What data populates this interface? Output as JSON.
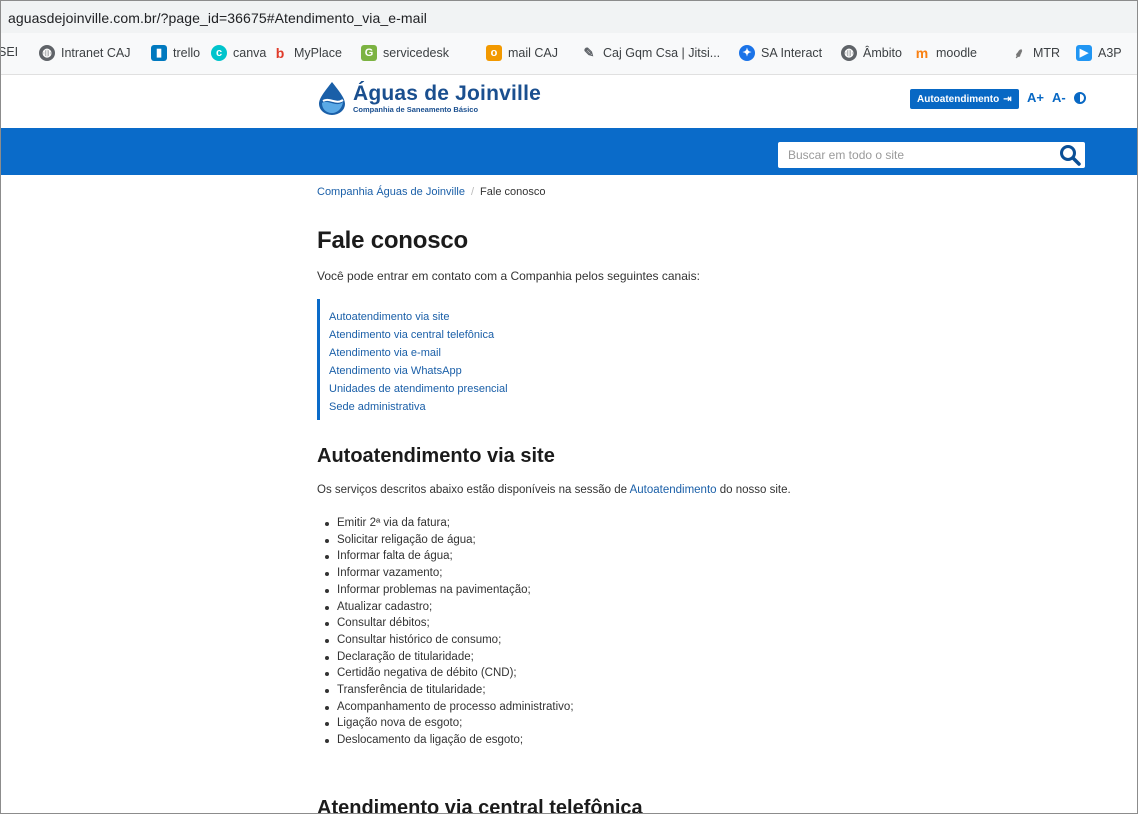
{
  "browser": {
    "url": "aguasdejoinville.com.br/?page_id=36675#Atendimento_via_e-mail"
  },
  "bookmarks": [
    {
      "label": "SEI",
      "icon": "none"
    },
    {
      "label": "Intranet CAJ",
      "icon": "globe-icon"
    },
    {
      "label": "trello",
      "icon": "trello-icon"
    },
    {
      "label": "canva",
      "icon": "canva-icon"
    },
    {
      "label": "MyPlace",
      "icon": "myplace-icon"
    },
    {
      "label": "servicedesk",
      "icon": "servicedesk-icon"
    },
    {
      "label": "mail CAJ",
      "icon": "mail-icon"
    },
    {
      "label": "Caj Gqm Csa | Jitsi...",
      "icon": "feather-icon"
    },
    {
      "label": "SA Interact",
      "icon": "sa-interact-icon"
    },
    {
      "label": "Âmbito",
      "icon": "globe-icon"
    },
    {
      "label": "moodle",
      "icon": "moodle-icon"
    },
    {
      "label": "MTR",
      "icon": "mtr-icon"
    },
    {
      "label": "A3P",
      "icon": "a3p-icon"
    }
  ],
  "header": {
    "logo_name": "Águas de Joinville",
    "logo_sub": "Companhia de Saneamento Básico",
    "auto_label": "Autoatendimento",
    "font_increase": "A+",
    "font_decrease": "A-"
  },
  "search": {
    "placeholder": "Buscar em todo o site"
  },
  "breadcrumb": {
    "home": "Companhia Águas de Joinville",
    "separator": "/",
    "current": "Fale conosco"
  },
  "page": {
    "title": "Fale conosco",
    "intro": "Você pode entrar em contato com a Companhia pelos seguintes canais:",
    "toc": [
      "Autoatendimento via site",
      "Atendimento via central telefônica",
      "Atendimento via e-mail",
      "Atendimento via WhatsApp",
      "Unidades de atendimento presencial",
      "Sede administrativa"
    ],
    "section1": {
      "title": "Autoatendimento via site",
      "text_before": "Os serviços descritos abaixo estão disponíveis na sessão de ",
      "link": "Autoatendimento",
      "text_after": " do nosso site.",
      "services": [
        "Emitir 2ª via da fatura;",
        "Solicitar religação de água;",
        "Informar falta de água;",
        "Informar vazamento;",
        "Informar problemas na pavimentação;",
        "Atualizar cadastro;",
        "Consultar débitos;",
        "Consultar histórico de consumo;",
        "Declaração de titularidade;",
        "Certidão negativa de débito (CND);",
        "Transferência de titularidade;",
        "Acompanhamento de processo administrativo;",
        "Ligação nova de esgoto;",
        "Deslocamento da ligação de esgoto;"
      ]
    },
    "section2_title": "Atendimento via central telefônica"
  },
  "colors": {
    "brand_blue": "#0a6bc9",
    "logo_blue": "#1a4f8f",
    "link_blue": "#1a5fa8"
  }
}
